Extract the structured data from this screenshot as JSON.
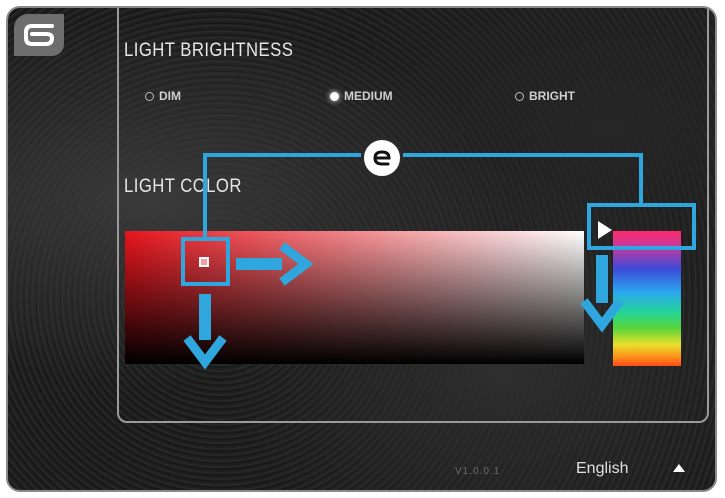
{
  "brightness": {
    "title": "LIGHT BRIGHTNESS",
    "options": [
      {
        "label": "DIM",
        "selected": false
      },
      {
        "label": "MEDIUM",
        "selected": true
      },
      {
        "label": "BRIGHT",
        "selected": false
      }
    ]
  },
  "color": {
    "title": "LIGHT COLOR",
    "hue_gradient": [
      "#ff2a6a",
      "#c43aa0",
      "#3c4ad8",
      "#2aa6f0",
      "#24d49a",
      "#58d43a",
      "#e8e02a",
      "#ff8a1a",
      "#ff4a1a"
    ],
    "picker_base_color": "#e8141c"
  },
  "footer": {
    "version": "V1.0.0.1",
    "language": "English"
  },
  "annotations": {
    "accent_color": "#2fa7de",
    "icons": [
      "step-6-badge",
      "step-e-badge",
      "arrow-right-icon",
      "arrow-down-icon",
      "play-triangle-icon",
      "caret-up-icon"
    ]
  }
}
